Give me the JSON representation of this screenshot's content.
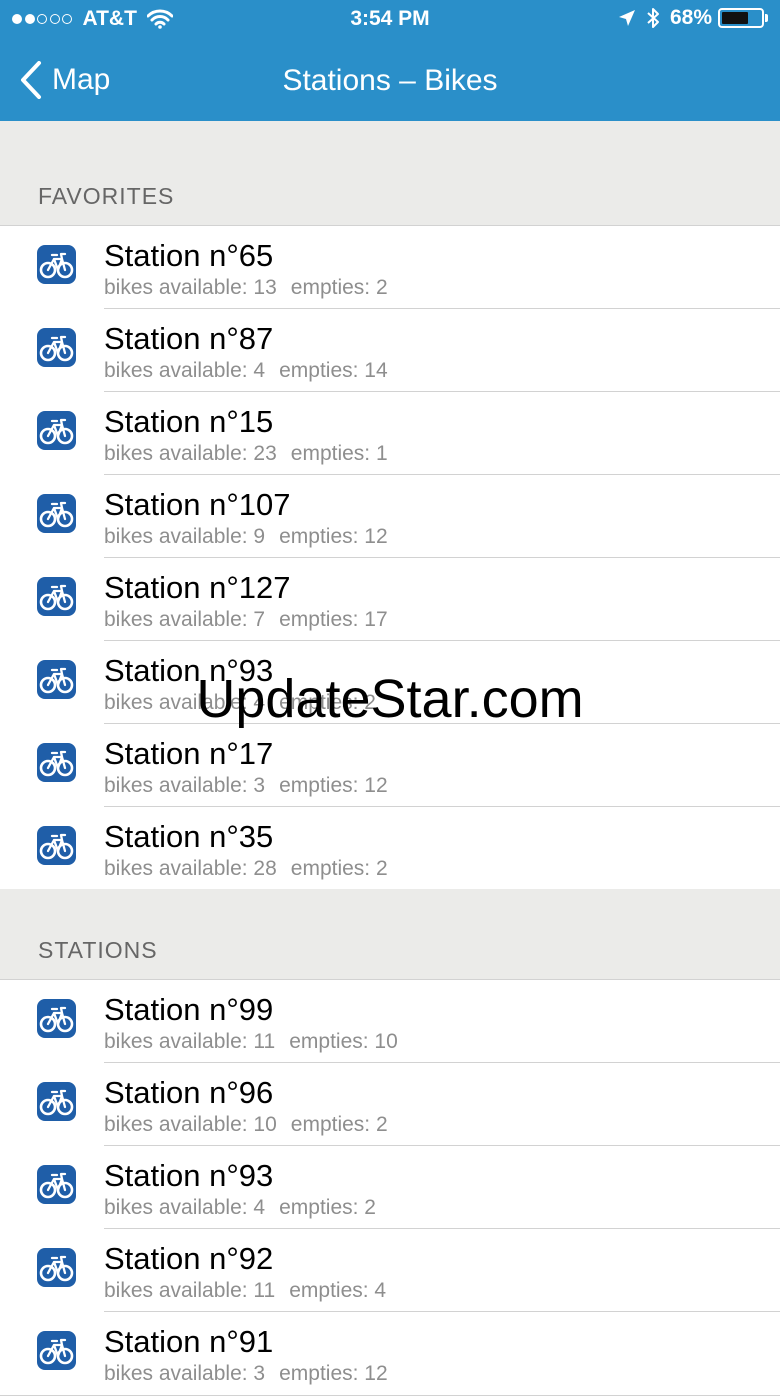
{
  "status_bar": {
    "carrier": "AT&T",
    "time": "3:54 PM",
    "battery_percent": "68%",
    "battery_level": 0.68,
    "signal_bars_filled": 2,
    "signal_bars_total": 5,
    "icons": [
      "wifi-icon",
      "location-arrow-icon",
      "bluetooth-icon",
      "battery-icon"
    ]
  },
  "navbar": {
    "back_label": "Map",
    "title": "Stations – Bikes",
    "color": "#2a8fc9"
  },
  "sections": [
    {
      "header": "FAVORITES",
      "items": [
        {
          "name": "Station n°65",
          "bikes": "bikes available: 13",
          "empties": "empties: 2"
        },
        {
          "name": "Station n°87",
          "bikes": "bikes available: 4",
          "empties": "empties: 14"
        },
        {
          "name": "Station n°15",
          "bikes": "bikes available: 23",
          "empties": "empties: 1"
        },
        {
          "name": "Station n°107",
          "bikes": "bikes available: 9",
          "empties": "empties: 12"
        },
        {
          "name": "Station n°127",
          "bikes": "bikes available: 7",
          "empties": "empties: 17"
        },
        {
          "name": "Station n°93",
          "bikes": "bikes available: 4",
          "empties": "empties: 2"
        },
        {
          "name": "Station n°17",
          "bikes": "bikes available: 3",
          "empties": "empties: 12"
        },
        {
          "name": "Station n°35",
          "bikes": "bikes available: 28",
          "empties": "empties: 2"
        }
      ]
    },
    {
      "header": "STATIONS",
      "items": [
        {
          "name": "Station n°99",
          "bikes": "bikes available: 11",
          "empties": "empties: 10"
        },
        {
          "name": "Station n°96",
          "bikes": "bikes available: 10",
          "empties": "empties: 2"
        },
        {
          "name": "Station n°93",
          "bikes": "bikes available: 4",
          "empties": "empties: 2"
        },
        {
          "name": "Station n°92",
          "bikes": "bikes available: 11",
          "empties": "empties: 4"
        },
        {
          "name": "Station n°91",
          "bikes": "bikes available: 3",
          "empties": "empties: 12"
        }
      ]
    }
  ],
  "watermark": "UpdateStar.com",
  "colors": {
    "accent": "#2a8fc9",
    "icon_blue": "#1f5ea8",
    "section_bg": "#ebebe9",
    "subtitle_gray": "#8e8e8e"
  }
}
